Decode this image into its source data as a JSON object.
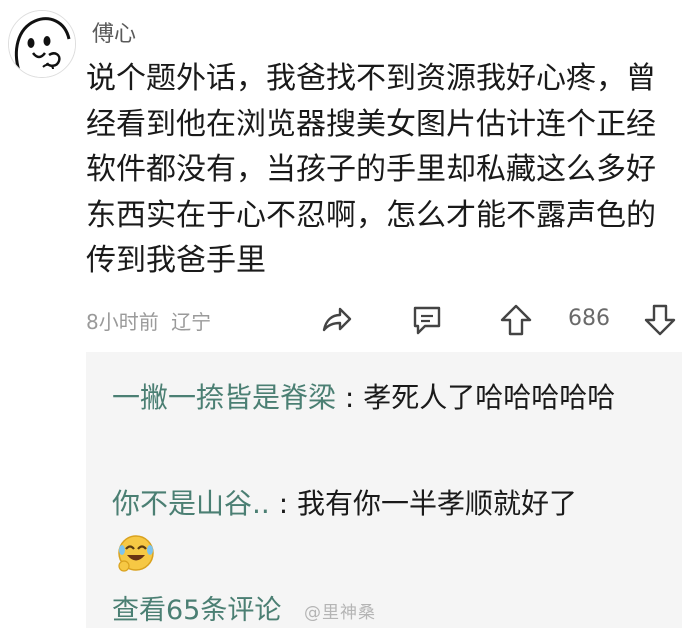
{
  "post": {
    "username": "傅心",
    "text_lines": [
      "说个题外话，我爸找不到资源我好心疼，曾",
      "经看到他在浏览器搜美女图片估计连个正经",
      "软件都没有，当孩子的手里却私藏这么多好",
      "东西实在于心不忍啊，怎么才能不露声色的",
      "传到我爸手里"
    ],
    "time": "8小时前",
    "location": "辽宁",
    "likes": "686"
  },
  "icons": {
    "share": "share-icon",
    "comment": "comment-icon",
    "upvote": "upvote-icon",
    "downvote": "downvote-icon",
    "emoji": "laughing-emoji-icon"
  },
  "replies": [
    {
      "name": "一撇一捺皆是脊梁",
      "separator": " : ",
      "text": "孝死人了哈哈哈哈哈"
    },
    {
      "name": "你不是山谷..",
      "separator": " : ",
      "text": "我有你一半孝顺就好了"
    }
  ],
  "view_more": "查看65条评论",
  "watermark": "@里神桑",
  "colors": {
    "accent": "#4b7f73",
    "meta": "#9a9a9a",
    "reply_bg": "#f5f5f5"
  }
}
